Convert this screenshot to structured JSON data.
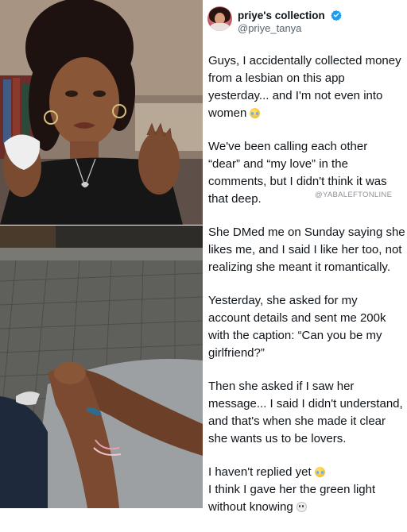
{
  "post": {
    "display_name": "priye's collection",
    "handle": "@priye_tanya",
    "verified": true,
    "accent_color": "#1d9bf0",
    "icons": {
      "avatar": "avatar-photo",
      "verified": "verified-badge-icon",
      "laugh_cry": "crying-laughing-emoji",
      "skull": "skull-emoji"
    },
    "paragraphs": [
      {
        "lines": [
          "Guys, I accidentally collected money",
          "from a lesbian on this app",
          "yesterday... and I'm not even into",
          "women"
        ],
        "emoji": "cry"
      },
      {
        "lines": [
          "We've been calling each other",
          "“dear” and “my love” in the",
          "comments, but I didn't think it was",
          "that deep."
        ]
      },
      {
        "lines": [
          "She DMed me on Sunday saying she",
          "likes me, and I said I like her too, not",
          "realizing she meant it romantically."
        ]
      },
      {
        "lines": [
          "Yesterday, she asked for my",
          "account details and sent me 200k",
          "with the caption: “Can you be my",
          "girlfriend?”"
        ]
      },
      {
        "lines": [
          "Then she asked if I saw her",
          "message... I said I didn't understand,",
          "and that's when she made it clear",
          "she wants us to be lovers."
        ]
      },
      {
        "lines": [
          "I haven't replied yet",
          "I think I gave her the green light",
          "without knowing"
        ]
      }
    ]
  },
  "watermark": "@YABALEFTONLINE"
}
